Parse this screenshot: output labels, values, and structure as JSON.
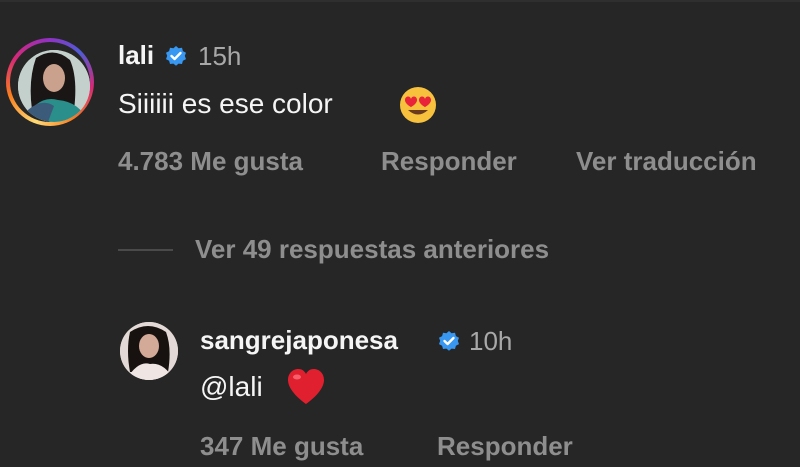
{
  "comment": {
    "username": "lali",
    "time": "15h",
    "text": "Siiiiii es ese color",
    "likes": "4.783 Me gusta",
    "reply_label": "Responder",
    "translate_label": "Ver traducción",
    "emoji": "heart-eyes-emoji"
  },
  "view_replies_label": "Ver 49 respuestas anteriores",
  "reply": {
    "username": "sangrejaponesa",
    "time": "10h",
    "text": "@lali",
    "likes": "347 Me gusta",
    "reply_label": "Responder",
    "emoji": "red-heart-emoji"
  },
  "colors": {
    "background": "#262626",
    "verified": "#3897f0",
    "secondary_text": "#8e8e8e"
  }
}
